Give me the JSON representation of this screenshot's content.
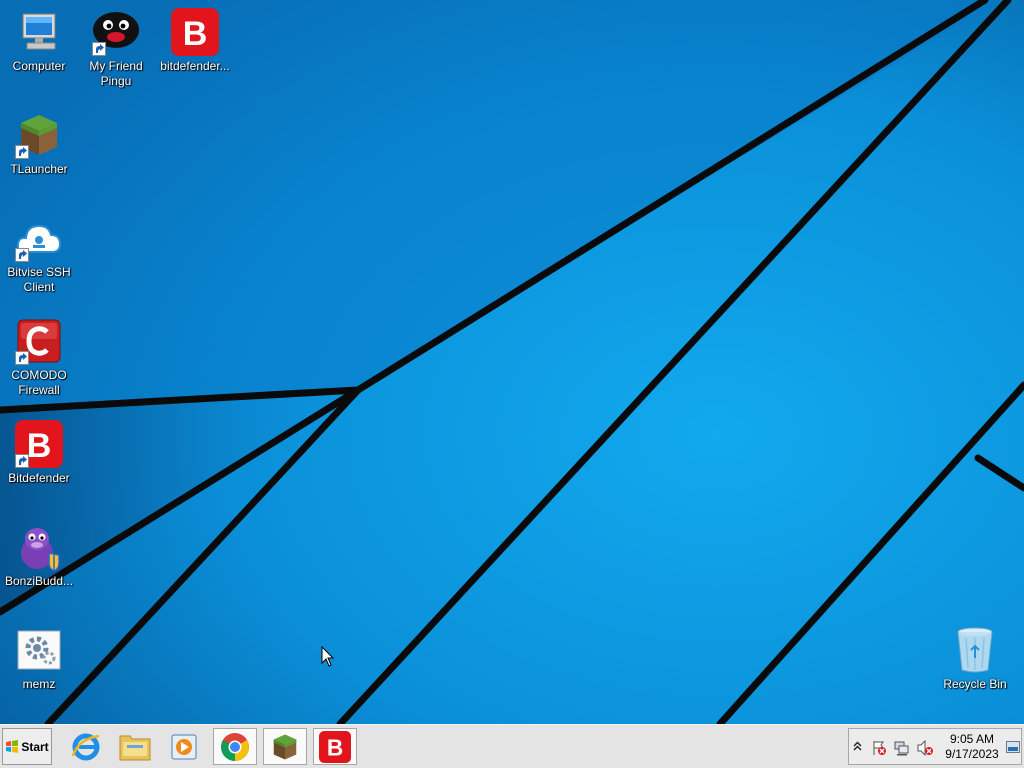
{
  "desktop": {
    "icons": [
      {
        "label": "Computer",
        "icon": "computer-icon"
      },
      {
        "label": "My Friend\nPingu",
        "icon": "pingu-icon"
      },
      {
        "label": "bitdefender...",
        "icon": "bitdefender-icon"
      },
      {
        "label": "TLauncher",
        "icon": "minecraft-grass-icon"
      },
      {
        "label": "Bitvise SSH\nClient",
        "icon": "bitvise-cloud-icon"
      },
      {
        "label": "COMODO\nFirewall",
        "icon": "comodo-icon"
      },
      {
        "label": "Bitdefender",
        "icon": "bitdefender-icon"
      },
      {
        "label": "BonziBudd...",
        "icon": "bonzi-icon"
      },
      {
        "label": "memz",
        "icon": "gear-icon"
      },
      {
        "label": "Recycle Bin",
        "icon": "recycle-bin-icon"
      }
    ]
  },
  "taskbar": {
    "start_label": "Start",
    "apps": [
      "internet-explorer-icon",
      "file-explorer-icon",
      "media-player-icon",
      "chrome-icon",
      "minecraft-grass-icon",
      "bitdefender-icon"
    ],
    "tray": {
      "time": "9:05 AM",
      "date": "9/17/2023"
    }
  },
  "colors": {
    "wallpaper": "#0a8fd8",
    "bitdefender_red": "#e2141c",
    "taskbar": "#e4e4e4"
  }
}
